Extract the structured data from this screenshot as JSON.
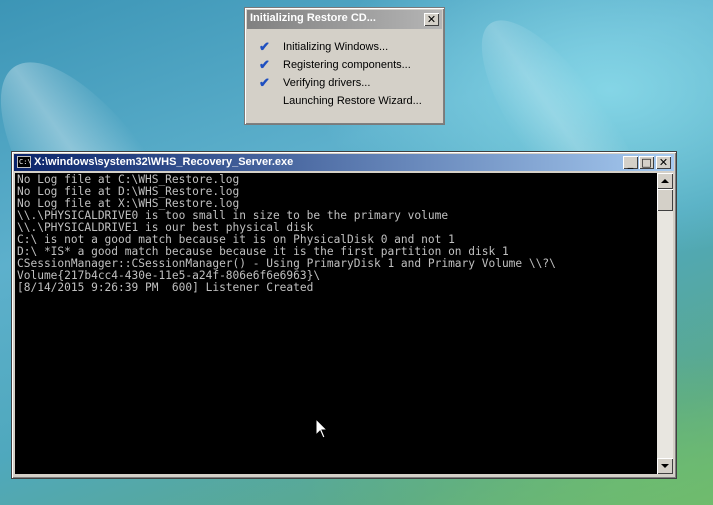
{
  "restore_dialog": {
    "title": "Initializing Restore CD...",
    "close_glyph": "✕",
    "check_glyph": "✔",
    "steps": [
      {
        "label": "Initializing Windows...",
        "done": true
      },
      {
        "label": "Registering components...",
        "done": true
      },
      {
        "label": "Verifying drivers...",
        "done": true
      },
      {
        "label": "Launching Restore Wizard...",
        "done": false
      }
    ]
  },
  "console": {
    "title": "X:\\windows\\system32\\WHS_Recovery_Server.exe",
    "icon_text": "C:\\",
    "minimize_glyph": "_",
    "maximize_glyph": "□",
    "close_glyph": "✕",
    "lines": [
      "No Log file at C:\\WHS_Restore.log",
      "No Log file at D:\\WHS_Restore.log",
      "No Log file at X:\\WHS_Restore.log",
      "\\\\.\\PHYSICALDRIVE0 is too small in size to be the primary volume",
      "\\\\.\\PHYSICALDRIVE1 is our best physical disk",
      "C:\\ is not a good match because it is on PhysicalDisk 0 and not 1",
      "D:\\ *IS* a good match because because it is the first partition on disk 1",
      "CSessionManager::CSessionManager() - Using PrimaryDisk 1 and Primary Volume \\\\?\\",
      "Volume{217b4cc4-430e-11e5-a24f-806e6f6e6963}\\",
      "[8/14/2015 9:26:39 PM  600] Listener Created"
    ]
  },
  "icons": {
    "cursor": "arrow-cursor-icon",
    "check": "checkmark-icon",
    "console": "console-app-icon"
  },
  "colors": {
    "console_bg": "#000000",
    "console_text": "#c0c0c0",
    "active_titlebar": "#0a246a",
    "inactive_titlebar": "#808080",
    "check": "#1e4fc0"
  }
}
